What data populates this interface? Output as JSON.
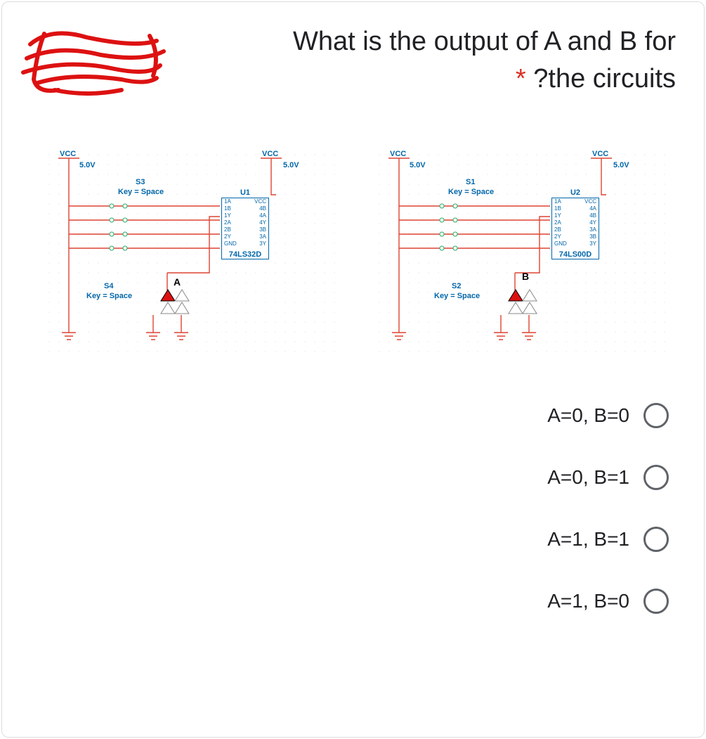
{
  "question": {
    "line1": "What is the output of A and B for",
    "line2": "?the circuits",
    "required_marker": "*"
  },
  "circuits": {
    "left": {
      "vcc1": {
        "label": "VCC",
        "voltage": "5.0V"
      },
      "vcc2": {
        "label": "VCC",
        "voltage": "5.0V"
      },
      "switch_top": {
        "name": "S3",
        "key": "Key = Space"
      },
      "switch_bottom": {
        "name": "S4",
        "key": "Key = Space"
      },
      "chip": {
        "title": "U1",
        "part": "74LS32D",
        "pins_left": [
          "1A",
          "1B",
          "1Y",
          "2A",
          "2B",
          "2Y",
          "GND"
        ],
        "pins_right": [
          "VCC",
          "4B",
          "4A",
          "4Y",
          "3B",
          "3A",
          "3Y"
        ]
      },
      "output_label": "A"
    },
    "right": {
      "vcc1": {
        "label": "VCC",
        "voltage": "5.0V"
      },
      "vcc2": {
        "label": "VCC",
        "voltage": "5.0V"
      },
      "switch_top": {
        "name": "S1",
        "key": "Key = Space"
      },
      "switch_bottom": {
        "name": "S2",
        "key": "Key = Space"
      },
      "chip": {
        "title": "U2",
        "part": "74LS00D",
        "pins_left": [
          "1A",
          "1B",
          "1Y",
          "2A",
          "2B",
          "2Y",
          "GND"
        ],
        "pins_right": [
          "VCC",
          "4A",
          "4B",
          "4Y",
          "3A",
          "3B",
          "3Y"
        ]
      },
      "output_label": "B"
    }
  },
  "options": [
    {
      "label": "A=0, B=0"
    },
    {
      "label": "A=0, B=1"
    },
    {
      "label": "A=1, B=1"
    },
    {
      "label": "A=1, B=0"
    }
  ]
}
